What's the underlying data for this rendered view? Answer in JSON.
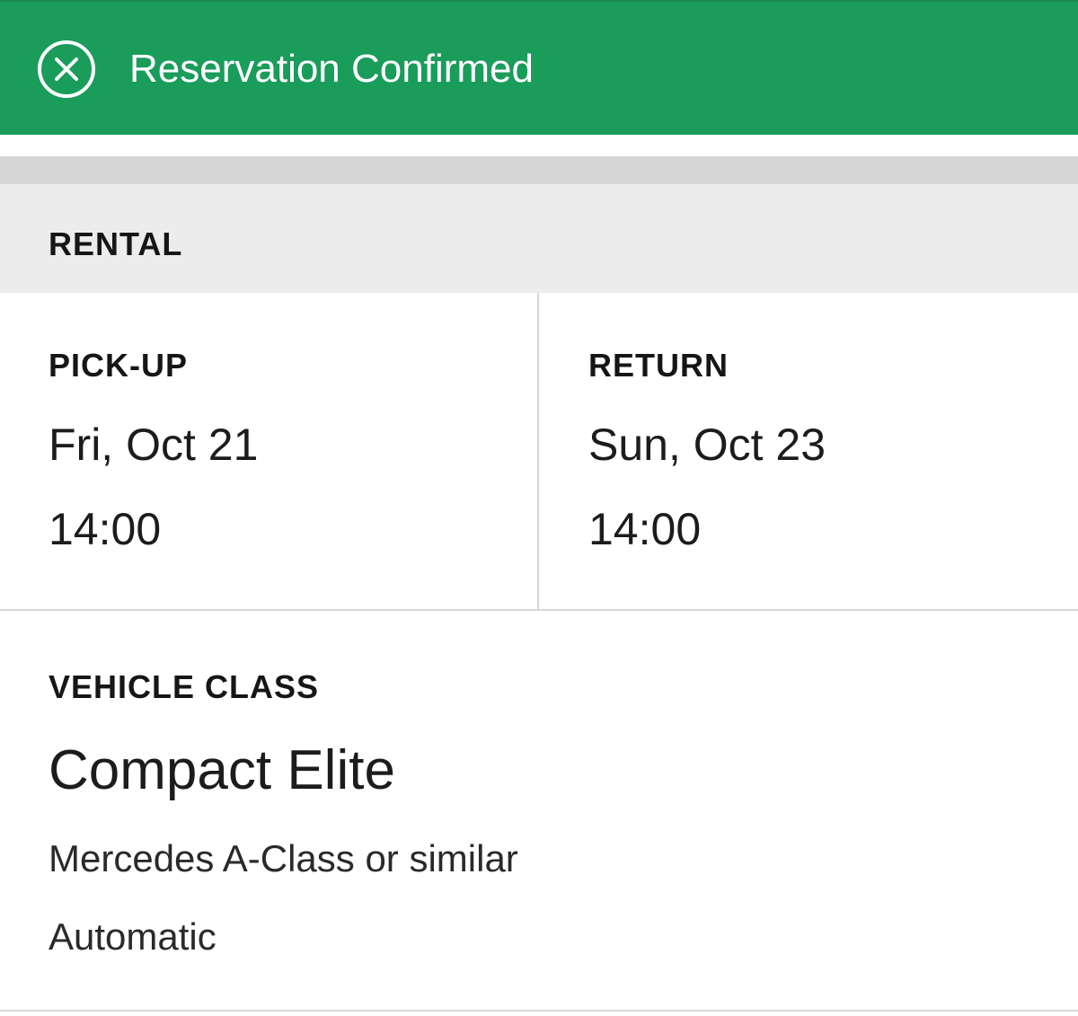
{
  "banner": {
    "title": "Reservation Confirmed",
    "icon": "close-circle-icon",
    "color": "#1a9c5b"
  },
  "rental": {
    "section_title": "RENTAL",
    "pickup": {
      "label": "PICK-UP",
      "date": "Fri, Oct 21",
      "time": "14:00"
    },
    "return": {
      "label": "RETURN",
      "date": "Sun, Oct 23",
      "time": "14:00"
    }
  },
  "vehicle": {
    "label": "VEHICLE CLASS",
    "class_name": "Compact Elite",
    "model": "Mercedes A-Class or similar",
    "transmission": "Automatic"
  }
}
